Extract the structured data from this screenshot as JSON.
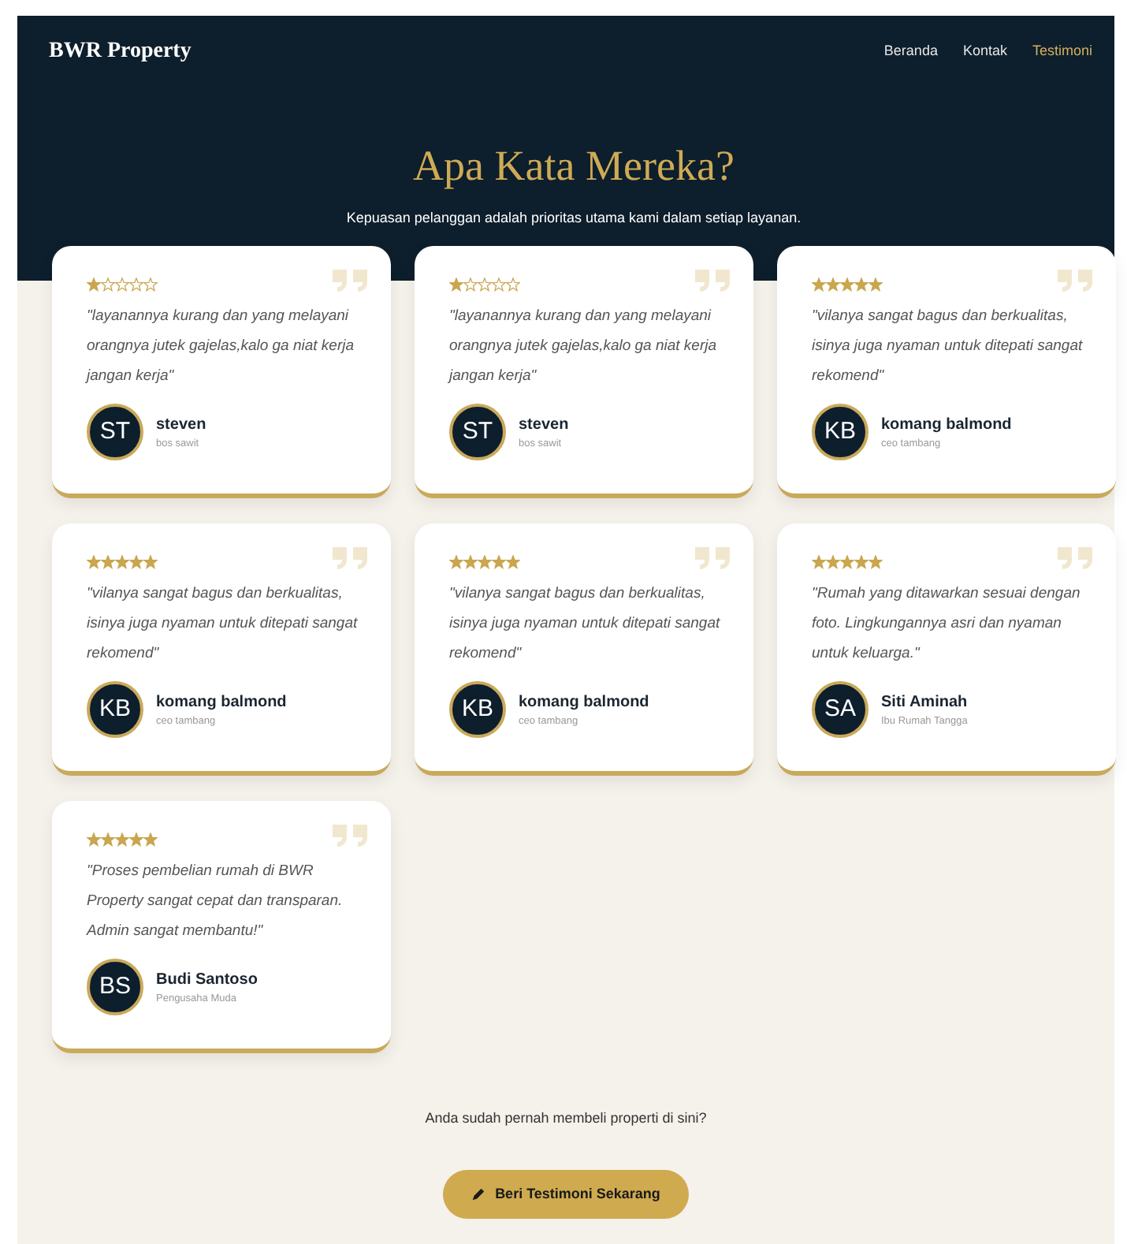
{
  "navbar": {
    "brand": "BWR Property",
    "links": [
      {
        "label": "Beranda",
        "selected": false
      },
      {
        "label": "Kontak",
        "selected": false
      },
      {
        "label": "Testimoni",
        "selected": true
      }
    ]
  },
  "hero": {
    "title": "Apa Kata Mereka?",
    "subtitle": "Kepuasan pelanggan adalah prioritas utama kami dalam setiap layanan."
  },
  "testimonials": [
    {
      "stars": 1,
      "quote": "\"layanannya kurang dan yang melayani orangnya jutek gajelas,kalo ga niat kerja jangan kerja\"",
      "initials": "ST",
      "name": "steven",
      "role": "bos sawit"
    },
    {
      "stars": 1,
      "quote": "\"layanannya kurang dan yang melayani orangnya jutek gajelas,kalo ga niat kerja jangan kerja\"",
      "initials": "ST",
      "name": "steven",
      "role": "bos sawit"
    },
    {
      "stars": 5,
      "quote": "\"vilanya sangat bagus dan berkualitas, isinya juga nyaman untuk ditepati sangat rekomend\"",
      "initials": "KB",
      "name": "komang balmond",
      "role": "ceo tambang"
    },
    {
      "stars": 5,
      "quote": "\"vilanya sangat bagus dan berkualitas, isinya juga nyaman untuk ditepati sangat rekomend\"",
      "initials": "KB",
      "name": "komang balmond",
      "role": "ceo tambang"
    },
    {
      "stars": 5,
      "quote": "\"vilanya sangat bagus dan berkualitas, isinya juga nyaman untuk ditepati sangat rekomend\"",
      "initials": "KB",
      "name": "komang balmond",
      "role": "ceo tambang"
    },
    {
      "stars": 5,
      "quote": "\"Rumah yang ditawarkan sesuai dengan foto. Lingkungannya asri dan nyaman untuk keluarga.\"",
      "initials": "SA",
      "name": "Siti Aminah",
      "role": "Ibu Rumah Tangga"
    },
    {
      "stars": 5,
      "quote": "\"Proses pembelian rumah di BWR Property sangat cepat dan transparan. Admin sangat membantu!\"",
      "initials": "BS",
      "name": "Budi Santoso",
      "role": "Pengusaha Muda"
    }
  ],
  "cta": {
    "prompt": "Anda sudah pernah membeli properti di sini?",
    "button": "Beri Testimoni Sekarang"
  }
}
